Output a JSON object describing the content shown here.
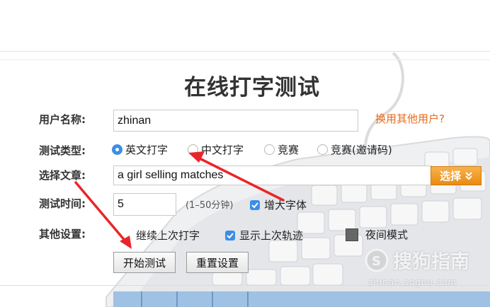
{
  "title": "在线打字测试",
  "form": {
    "username_label": "用户名称:",
    "username_value": "zhinan",
    "change_user_link": "换用其他用户?",
    "type_label": "测试类型:",
    "type_options": [
      "英文打字",
      "中文打字",
      "竞赛",
      "竞赛(邀请码)"
    ],
    "type_selected": "英文打字",
    "article_label": "选择文章:",
    "article_value": "a girl selling matches",
    "select_button": "选择",
    "time_label": "测试时间:",
    "time_value": "5",
    "time_hint": "(1–50分钟)",
    "enlarge_font_label": "增大字体",
    "enlarge_font_checked": true,
    "other_label": "其他设置:",
    "continue_last_label": "继续上次打字",
    "show_track_label": "显示上次轨迹",
    "show_track_checked": true,
    "night_mode_label": "夜间模式"
  },
  "buttons": {
    "start": "开始测试",
    "reset": "重置设置"
  },
  "watermark": {
    "brand": "搜狗指南",
    "url": "zhinan.sogou.com"
  },
  "colors": {
    "accent_blue": "#3a8ee6",
    "link_orange": "#e86a18",
    "select_orange": "#f0a030",
    "arrow_red": "#e8262a"
  }
}
